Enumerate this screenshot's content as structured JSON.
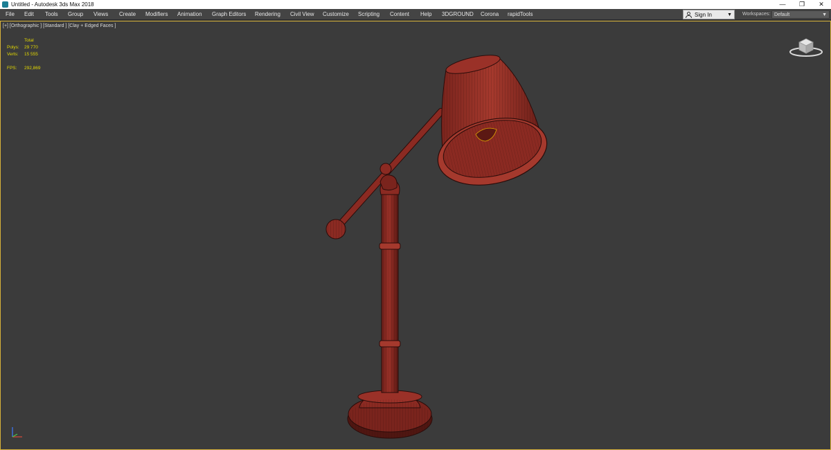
{
  "window": {
    "title": "Untitled - Autodesk 3ds Max 2018",
    "controls": {
      "minimize": "—",
      "restore": "❐",
      "close": "✕"
    }
  },
  "menu": [
    "File",
    "Edit",
    "Tools",
    "Group",
    "Views",
    "Create",
    "Modifiers",
    "Animation",
    "Graph Editors",
    "Rendering",
    "Civil View",
    "Customize",
    "Scripting",
    "Content",
    "Help",
    "3DGROUND",
    "Corona",
    "rapidTools"
  ],
  "signin": {
    "label": "Sign In",
    "icon": "user-icon"
  },
  "workspaces": {
    "label": "Workspaces:",
    "value": "Default"
  },
  "viewport": {
    "label": "[+] [Orthographic ] [Standard ] [Clay + Edged Faces ]",
    "stats": {
      "header": "Total",
      "polys_label": "Polys:",
      "polys": "29 770",
      "verts_label": "Verts:",
      "verts": "15 555",
      "fps_label": "FPS:",
      "fps": "292,869"
    }
  },
  "colors": {
    "model": "#8b2a22",
    "wire": "#2a0c0a",
    "stats": "#e3d800",
    "viewport_border": "#d8b23a"
  }
}
